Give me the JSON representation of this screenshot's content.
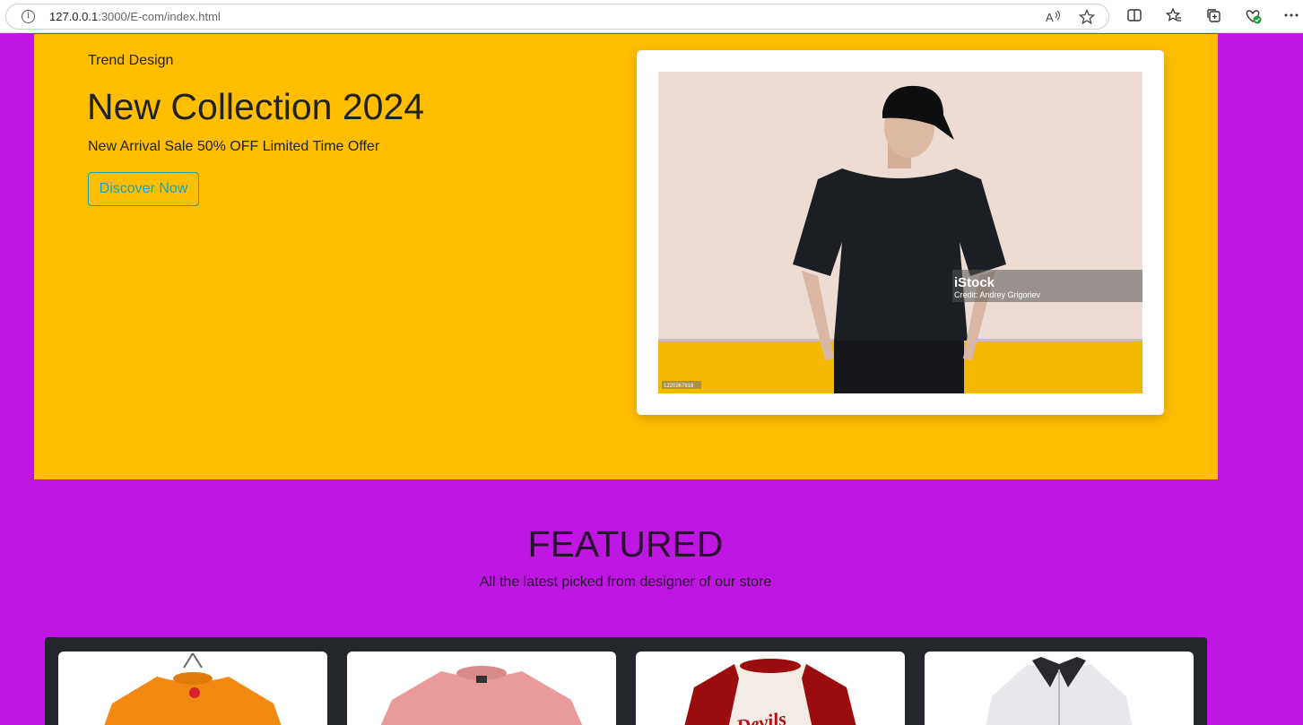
{
  "browser": {
    "url_host": "127.0.0.1",
    "url_path": ":3000/E-com/index.html"
  },
  "hero": {
    "kicker": "Trend Design",
    "title": "New Collection 2024",
    "subtitle": "New Arrival Sale 50% OFF Limited Time Offer",
    "cta_label": "Discover Now",
    "image_watermark": "iStock",
    "image_credit": "Credit: Andrey Grigoriev",
    "image_id": "1220367916"
  },
  "featured": {
    "title": "FEATURED",
    "subtitle": "All the latest picked from designer of our store"
  },
  "products": [
    {
      "image": "orange-tshirt"
    },
    {
      "image": "pink-tshirt"
    },
    {
      "image": "raglan-tshirt",
      "print_text": "Devils"
    },
    {
      "image": "white-shirt"
    }
  ],
  "colors": {
    "page_bg": "#bf16e3",
    "hero_bg": "#ffbe00",
    "accent": "#17a2b8",
    "products_bg": "#23272b"
  }
}
